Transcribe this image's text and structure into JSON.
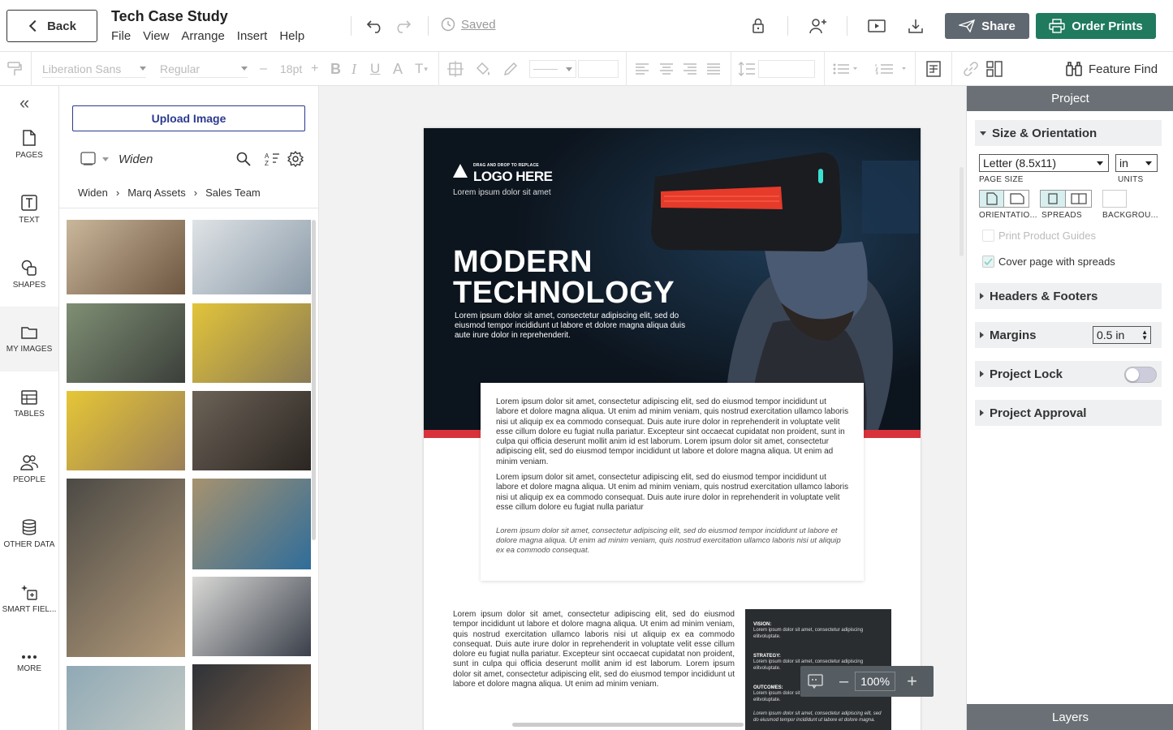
{
  "header": {
    "back_label": "Back",
    "title": "Tech Case Study",
    "menu": [
      "File",
      "View",
      "Arrange",
      "Insert",
      "Help"
    ],
    "saved_label": "Saved",
    "share_label": "Share",
    "order_label": "Order Prints"
  },
  "format_toolbar": {
    "font_family": "Liberation Sans",
    "font_weight": "Regular",
    "font_size": "18pt",
    "bold": "B",
    "italic": "I",
    "underline": "U",
    "font_color": "A",
    "text_transform": "T",
    "feature_find_label": "Feature Find"
  },
  "left_nav": {
    "collapse": "«",
    "items": [
      {
        "label": "PAGES",
        "icon": "page-icon"
      },
      {
        "label": "TEXT",
        "icon": "text-icon"
      },
      {
        "label": "SHAPES",
        "icon": "shapes-icon"
      },
      {
        "label": "MY IMAGES",
        "icon": "folder-icon"
      },
      {
        "label": "TABLES",
        "icon": "table-icon"
      },
      {
        "label": "PEOPLE",
        "icon": "people-icon"
      },
      {
        "label": "OTHER DATA",
        "icon": "database-icon"
      },
      {
        "label": "SMART FIEL...",
        "icon": "smart-field-icon"
      },
      {
        "label": "MORE",
        "icon": "more-icon"
      }
    ],
    "active_item": "MY IMAGES"
  },
  "image_panel": {
    "upload_label": "Upload Image",
    "source_name": "Widen",
    "breadcrumbs": [
      "Widen",
      "Marq Assets",
      "Sales Team"
    ],
    "thumbnails": [
      {
        "name": "tablet-desk",
        "colors": [
          "#c9b79b",
          "#6e5640"
        ]
      },
      {
        "name": "man-phone-office",
        "colors": [
          "#dfe3e6",
          "#8a9aa8"
        ]
      },
      {
        "name": "meeting-cafe",
        "colors": [
          "#7f8f74",
          "#3b3f3a"
        ]
      },
      {
        "name": "yellow-chair-phone",
        "colors": [
          "#e2c43a",
          "#8a7a55"
        ]
      },
      {
        "name": "yellow-chair-phone-2",
        "colors": [
          "#e6c636",
          "#9a7f57"
        ]
      },
      {
        "name": "laptop-office-woman",
        "colors": [
          "#6c6257",
          "#2b2622"
        ]
      },
      {
        "name": "man-laptop-headphones",
        "colors": [
          "#4c4a45",
          "#b39a7a"
        ]
      },
      {
        "name": "office-meeting-blue",
        "colors": [
          "#a7926f",
          "#2f6d9a"
        ]
      },
      {
        "name": "man-laptop-suit",
        "colors": [
          "#d9d9d6",
          "#3a3f4a"
        ]
      },
      {
        "name": "window-glass",
        "colors": [
          "#8fa9b5",
          "#c3c9c5"
        ]
      },
      {
        "name": "suit-coffee",
        "colors": [
          "#2f3238",
          "#7a6049"
        ]
      }
    ]
  },
  "document": {
    "logo_small": "DRAG AND DROP TO REPLACE",
    "logo_big": "LOGO HERE",
    "logo_sub": "Lorem ipsum dolor sit amet",
    "hero_title_1": "MODERN",
    "hero_title_2": "TECHNOLOGY",
    "hero_sub": "Lorem ipsum dolor sit amet, consectetur adipiscing elit, sed do eiusmod tempor incididunt ut labore et dolore magna aliqua duis aute irure dolor in reprehenderit.",
    "box_p1": "Lorem ipsum dolor sit amet, consectetur adipiscing elit, sed do eiusmod tempor incididunt ut labore et dolore magna aliqua. Ut enim ad minim veniam, quis nostrud exercitation ullamco laboris nisi ut aliquip ex ea commodo consequat. Duis aute irure dolor in reprehenderit in voluptate velit esse cillum dolore eu fugiat nulla pariatur. Excepteur sint occaecat cupidatat non proident, sunt in culpa qui officia deserunt mollit anim id est laborum. Lorem ipsum dolor sit amet, consectetur adipiscing elit, sed do eiusmod tempor incididunt ut labore et dolore magna aliqua. Ut enim ad minim veniam.",
    "box_p2": "Lorem ipsum dolor sit amet, consectetur adipiscing elit, sed do eiusmod tempor incididunt ut labore et dolore magna aliqua. Ut enim ad minim veniam, quis nostrud exercitation ullamco laboris nisi ut aliquip ex ea commodo consequat. Duis aute irure dolor in reprehenderit in voluptate velit esse cillum dolore eu fugiat nulla pariatur",
    "box_p3": "Lorem ipsum dolor sit amet, consectetur adipiscing elit, sed do eiusmod tempor incididunt ut labore et dolore magna aliqua. Ut enim ad minim veniam, quis nostrud exercitation ullamco laboris nisi ut aliquip ex ea commodo consequat.",
    "body_text": "Lorem ipsum dolor sit amet, consectetur adipiscing elit, sed do eiusmod tempor incididunt ut labore et dolore magna aliqua. Ut enim ad minim veniam, quis nostrud exercitation ullamco laboris nisi ut aliquip ex ea commodo consequat. Duis aute irure dolor in reprehenderit in voluptate velit esse cillum dolore eu fugiat nulla pariatur. Excepteur sint occaecat cupidatat non proident, sunt in culpa qui officia deserunt mollit anim id est laborum. Lorem ipsum dolor sit amet, consectetur adipiscing elit, sed do eiusmod tempor incididunt ut labore et dolore magna aliqua. Ut enim ad minim veniam.",
    "vision_h": "VISION:",
    "vision_d": "Lorem ipsum dolor sit amet, consectetur adipiscing elitvoluptate.",
    "strategy_h": "STRATEGY:",
    "strategy_d": "Lorem ipsum dolor sit amet, consectetur adipiscing elitvoluptate.",
    "outcomes_h": "OUTCOMES:",
    "outcomes_d": "Lorem ipsum dolor sit amet, consectetur adipiscing elitvoluptate.",
    "dark_foot": "Lorem ipsum dolor sit amet, consectetur adipiscing elit, sed do eiusmod tempor incididunt ut labore et dolore magna."
  },
  "zoom": {
    "value": "100%"
  },
  "right_panel": {
    "title": "Project",
    "size_section": "Size & Orientation",
    "page_size_value": "Letter (8.5x11)",
    "page_size_label": "PAGE SIZE",
    "units_value": "in",
    "units_label": "UNITS",
    "orientation_label": "ORIENTATIO...",
    "spreads_label": "SPREADS",
    "background_label": "BACKGROU...",
    "print_guides_label": "Print Product Guides",
    "cover_label": "Cover page with spreads",
    "headers_footers": "Headers & Footers",
    "margins": "Margins",
    "margins_value": "0.5 in",
    "project_lock": "Project Lock",
    "project_approval": "Project Approval",
    "layers": "Layers"
  },
  "colors": {
    "share_bg": "#5f6870",
    "order_bg": "#1f7a5e",
    "upload_accent": "#2b3a8f",
    "hero_red": "#d8333c",
    "panel_header": "#6a7075"
  }
}
